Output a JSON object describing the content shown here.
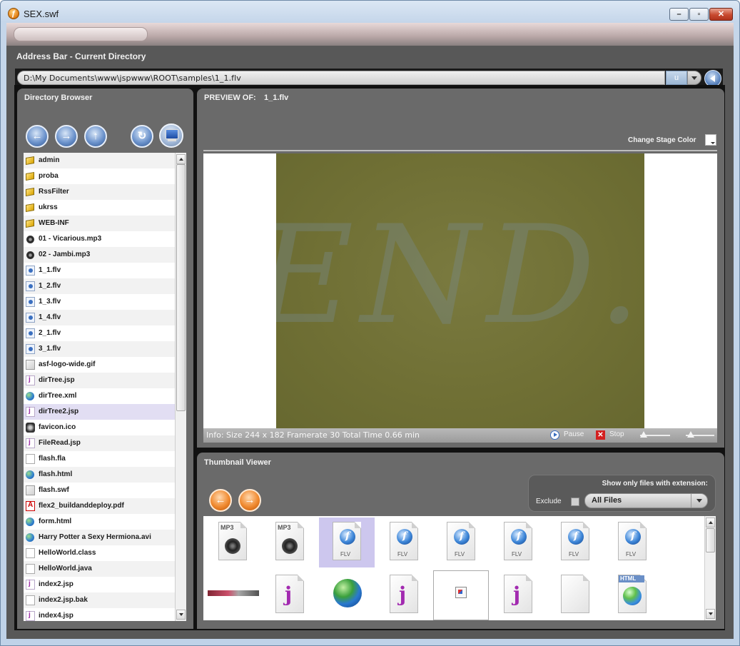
{
  "window": {
    "title": "SEX.swf"
  },
  "address": {
    "title": "Address Bar - Current Directory",
    "path": "D:\\My Documents\\www\\jspwww\\ROOT\\samples\\1_1.flv",
    "badge": "u"
  },
  "directory": {
    "title": "Directory Browser",
    "items": [
      {
        "name": "admin",
        "icon": "folder-icon"
      },
      {
        "name": "proba",
        "icon": "folder-icon"
      },
      {
        "name": "RssFilter",
        "icon": "folder-icon"
      },
      {
        "name": "ukrss",
        "icon": "folder-icon"
      },
      {
        "name": "WEB-INF",
        "icon": "folder-icon"
      },
      {
        "name": "01 - Vicarious.mp3",
        "icon": "audio-file-icon"
      },
      {
        "name": "02 - Jambi.mp3",
        "icon": "audio-file-icon"
      },
      {
        "name": "1_1.flv",
        "icon": "flv-file-icon"
      },
      {
        "name": "1_2.flv",
        "icon": "flv-file-icon"
      },
      {
        "name": "1_3.flv",
        "icon": "flv-file-icon"
      },
      {
        "name": "1_4.flv",
        "icon": "flv-file-icon"
      },
      {
        "name": "2_1.flv",
        "icon": "flv-file-icon"
      },
      {
        "name": "3_1.flv",
        "icon": "flv-file-icon"
      },
      {
        "name": "asf-logo-wide.gif",
        "icon": "image-file-icon"
      },
      {
        "name": "dirTree.jsp",
        "icon": "jsp-file-icon"
      },
      {
        "name": "dirTree.xml",
        "icon": "globe-file-icon"
      },
      {
        "name": "dirTree2.jsp",
        "icon": "jsp-file-icon"
      },
      {
        "name": "favicon.ico",
        "icon": "ico-file-icon"
      },
      {
        "name": "FileRead.jsp",
        "icon": "jsp-file-icon"
      },
      {
        "name": "flash.fla",
        "icon": "document-file-icon"
      },
      {
        "name": "flash.html",
        "icon": "globe-file-icon"
      },
      {
        "name": "flash.swf",
        "icon": "image-file-icon"
      },
      {
        "name": "flex2_buildanddeploy.pdf",
        "icon": "pdf-file-icon"
      },
      {
        "name": "form.html",
        "icon": "globe-file-icon"
      },
      {
        "name": "Harry Potter a Sexy Hermiona.avi",
        "icon": "globe-file-icon"
      },
      {
        "name": "HelloWorld.class",
        "icon": "document-file-icon"
      },
      {
        "name": "HelloWorld.java",
        "icon": "document-file-icon"
      },
      {
        "name": "index2.jsp",
        "icon": "jsp-file-icon"
      },
      {
        "name": "index2.jsp.bak",
        "icon": "document-file-icon"
      },
      {
        "name": "index4.jsp",
        "icon": "jsp-file-icon"
      }
    ],
    "selected": "dirTree2.jsp"
  },
  "preview": {
    "label": "PREVIEW OF:",
    "file": "1_1.flv",
    "stage_color_label": "Change Stage Color",
    "info": "Info:  Size 244 x 182  Framerate 30  Total Time 0.66 min",
    "pause_label": "Pause",
    "stop_label": "Stop",
    "video_text": "END."
  },
  "thumbnails": {
    "title": "Thumbnail Viewer",
    "filter_title": "Show only files with extension:",
    "exclude_label": "Exclude",
    "filter_value": "All Files",
    "row1": [
      {
        "type": "mp3",
        "label": "MP3"
      },
      {
        "type": "mp3",
        "label": "MP3"
      },
      {
        "type": "flv",
        "label": "FLV",
        "selected": true
      },
      {
        "type": "flv",
        "label": "FLV"
      },
      {
        "type": "flv",
        "label": "FLV"
      },
      {
        "type": "flv",
        "label": "FLV"
      },
      {
        "type": "flv",
        "label": "FLV"
      },
      {
        "type": "flv",
        "label": "FLV"
      }
    ],
    "row2": [
      {
        "type": "logo"
      },
      {
        "type": "jsp"
      },
      {
        "type": "globe"
      },
      {
        "type": "jsp"
      },
      {
        "type": "broken"
      },
      {
        "type": "jsp"
      },
      {
        "type": "blank"
      },
      {
        "type": "html",
        "label": "HTML"
      }
    ]
  },
  "colors": {
    "panel_bg": "#6a6a6a",
    "frame_bg": "#111111",
    "selected_row": "#e2def3",
    "selected_thumb": "#cdc7ee",
    "video_bg": "#707036",
    "nav_button": "#5d86c0",
    "thumb_nav_button": "#f08a30"
  }
}
